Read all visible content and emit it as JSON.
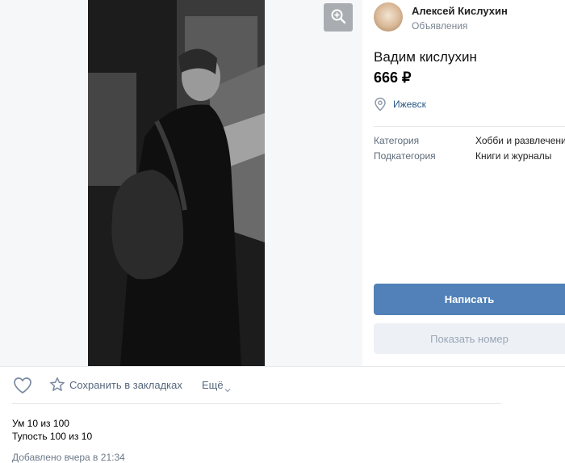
{
  "seller": {
    "name": "Алексей Кислухин",
    "subtitle": "Объявления"
  },
  "listing": {
    "title": "Вадим кислухин",
    "price": "666 ₽",
    "location": "Ижевск"
  },
  "properties": [
    {
      "label": "Категория",
      "value": "Хобби и развлечения"
    },
    {
      "label": "Подкатегория",
      "value": "Книги и журналы"
    }
  ],
  "buttons": {
    "write": "Написать",
    "show_phone": "Показать номер"
  },
  "actions": {
    "bookmark": "Сохранить в закладках",
    "more": "Ещё"
  },
  "description": [
    "Ум 10 из 100",
    "Тупость 100 из 10"
  ],
  "added": "Добавлено вчера в 21:34",
  "colors": {
    "accent": "#5181b8",
    "link": "#2a5885",
    "secondary_btn": "#edf1f6"
  },
  "icons": {
    "zoom": "zoom-in-icon",
    "location": "location-pin-icon",
    "like": "heart-icon",
    "bookmark": "star-icon",
    "more": "chevron-down-icon"
  }
}
